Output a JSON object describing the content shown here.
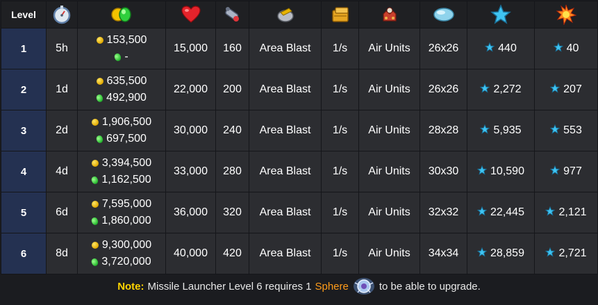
{
  "table": {
    "header": {
      "level": "Level",
      "icons": [
        "stopwatch-icon",
        "resources-icon",
        "heart-icon",
        "damage-icon",
        "attack-type-icon",
        "speed-icon",
        "target-icon",
        "size-icon",
        "xp-star-icon",
        "score-icon"
      ]
    },
    "rows": [
      {
        "level": "1",
        "time": "5h",
        "gold": "153,500",
        "gems": "-",
        "hp": "15,000",
        "damage": "160",
        "attack": "Area Blast",
        "speed": "1/s",
        "target": "Air Units",
        "size": "26x26",
        "xp": "440",
        "score": "40"
      },
      {
        "level": "2",
        "time": "1d",
        "gold": "635,500",
        "gems": "492,900",
        "hp": "22,000",
        "damage": "200",
        "attack": "Area Blast",
        "speed": "1/s",
        "target": "Air Units",
        "size": "26x26",
        "xp": "2,272",
        "score": "207"
      },
      {
        "level": "3",
        "time": "2d",
        "gold": "1,906,500",
        "gems": "697,500",
        "hp": "30,000",
        "damage": "240",
        "attack": "Area Blast",
        "speed": "1/s",
        "target": "Air Units",
        "size": "28x28",
        "xp": "5,935",
        "score": "553"
      },
      {
        "level": "4",
        "time": "4d",
        "gold": "3,394,500",
        "gems": "1,162,500",
        "hp": "33,000",
        "damage": "280",
        "attack": "Area Blast",
        "speed": "1/s",
        "target": "Air Units",
        "size": "30x30",
        "xp": "10,590",
        "score": "977"
      },
      {
        "level": "5",
        "time": "6d",
        "gold": "7,595,000",
        "gems": "1,860,000",
        "hp": "36,000",
        "damage": "320",
        "attack": "Area Blast",
        "speed": "1/s",
        "target": "Air Units",
        "size": "32x32",
        "xp": "22,445",
        "score": "2,121"
      },
      {
        "level": "6",
        "time": "8d",
        "gold": "9,300,000",
        "gems": "3,720,000",
        "hp": "40,000",
        "damage": "420",
        "attack": "Area Blast",
        "speed": "1/s",
        "target": "Air Units",
        "size": "34x34",
        "xp": "28,859",
        "score": "2,721"
      }
    ]
  },
  "note": {
    "label": "Note:",
    "text_before": "Missile Launcher Level 6 requires 1",
    "sphere": "Sphere",
    "text_after": "to be able to upgrade."
  },
  "colors": {
    "background": "#1b1c20",
    "header_bg": "#1f2023",
    "cell_bg": "#2c2d31",
    "level_bg": "#243151",
    "note_label": "#ffd400",
    "sphere_word": "#ff9c1a"
  }
}
